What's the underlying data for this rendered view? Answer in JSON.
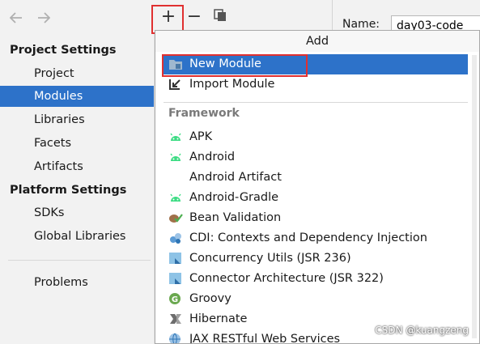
{
  "sidebar": {
    "project_settings_heading": "Project Settings",
    "project_items": [
      {
        "label": "Project"
      },
      {
        "label": "Modules",
        "selected": true
      },
      {
        "label": "Libraries"
      },
      {
        "label": "Facets"
      },
      {
        "label": "Artifacts"
      }
    ],
    "platform_settings_heading": "Platform Settings",
    "platform_items": [
      {
        "label": "SDKs"
      },
      {
        "label": "Global Libraries"
      }
    ],
    "problems_label": "Problems"
  },
  "toolbar": {
    "add_symbol": "+",
    "remove_symbol": "−",
    "icons": [
      "back-arrow-icon",
      "forward-arrow-icon",
      "copy-icon"
    ]
  },
  "name_field": {
    "label": "Name:",
    "value": "day03-code"
  },
  "popup": {
    "title": "Add",
    "top_items": [
      {
        "label": "New Module",
        "icon": "folder-icon",
        "selected": true
      },
      {
        "label": "Import Module",
        "icon": "import-arrow-icon"
      }
    ],
    "section_label": "Framework",
    "framework_items": [
      {
        "label": "APK",
        "icon": "android-icon"
      },
      {
        "label": "Android",
        "icon": "android-icon"
      },
      {
        "label": "Android Artifact",
        "icon": ""
      },
      {
        "label": "Android-Gradle",
        "icon": "android-icon"
      },
      {
        "label": "Bean Validation",
        "icon": "bean-validation-icon"
      },
      {
        "label": "CDI: Contexts and Dependency Injection",
        "icon": "cdi-icon"
      },
      {
        "label": "Concurrency Utils (JSR 236)",
        "icon": "jee-icon"
      },
      {
        "label": "Connector Architecture (JSR 322)",
        "icon": "jee-icon"
      },
      {
        "label": "Groovy",
        "icon": "groovy-icon"
      },
      {
        "label": "Hibernate",
        "icon": "hibernate-icon"
      },
      {
        "label": "JAX RESTful Web Services",
        "icon": "web-services-icon"
      }
    ]
  },
  "watermark": "CSDN @kuangzeng",
  "colors": {
    "selection": "#2d72c9",
    "highlight_border": "#e03030",
    "android_green": "#3ddc84"
  }
}
